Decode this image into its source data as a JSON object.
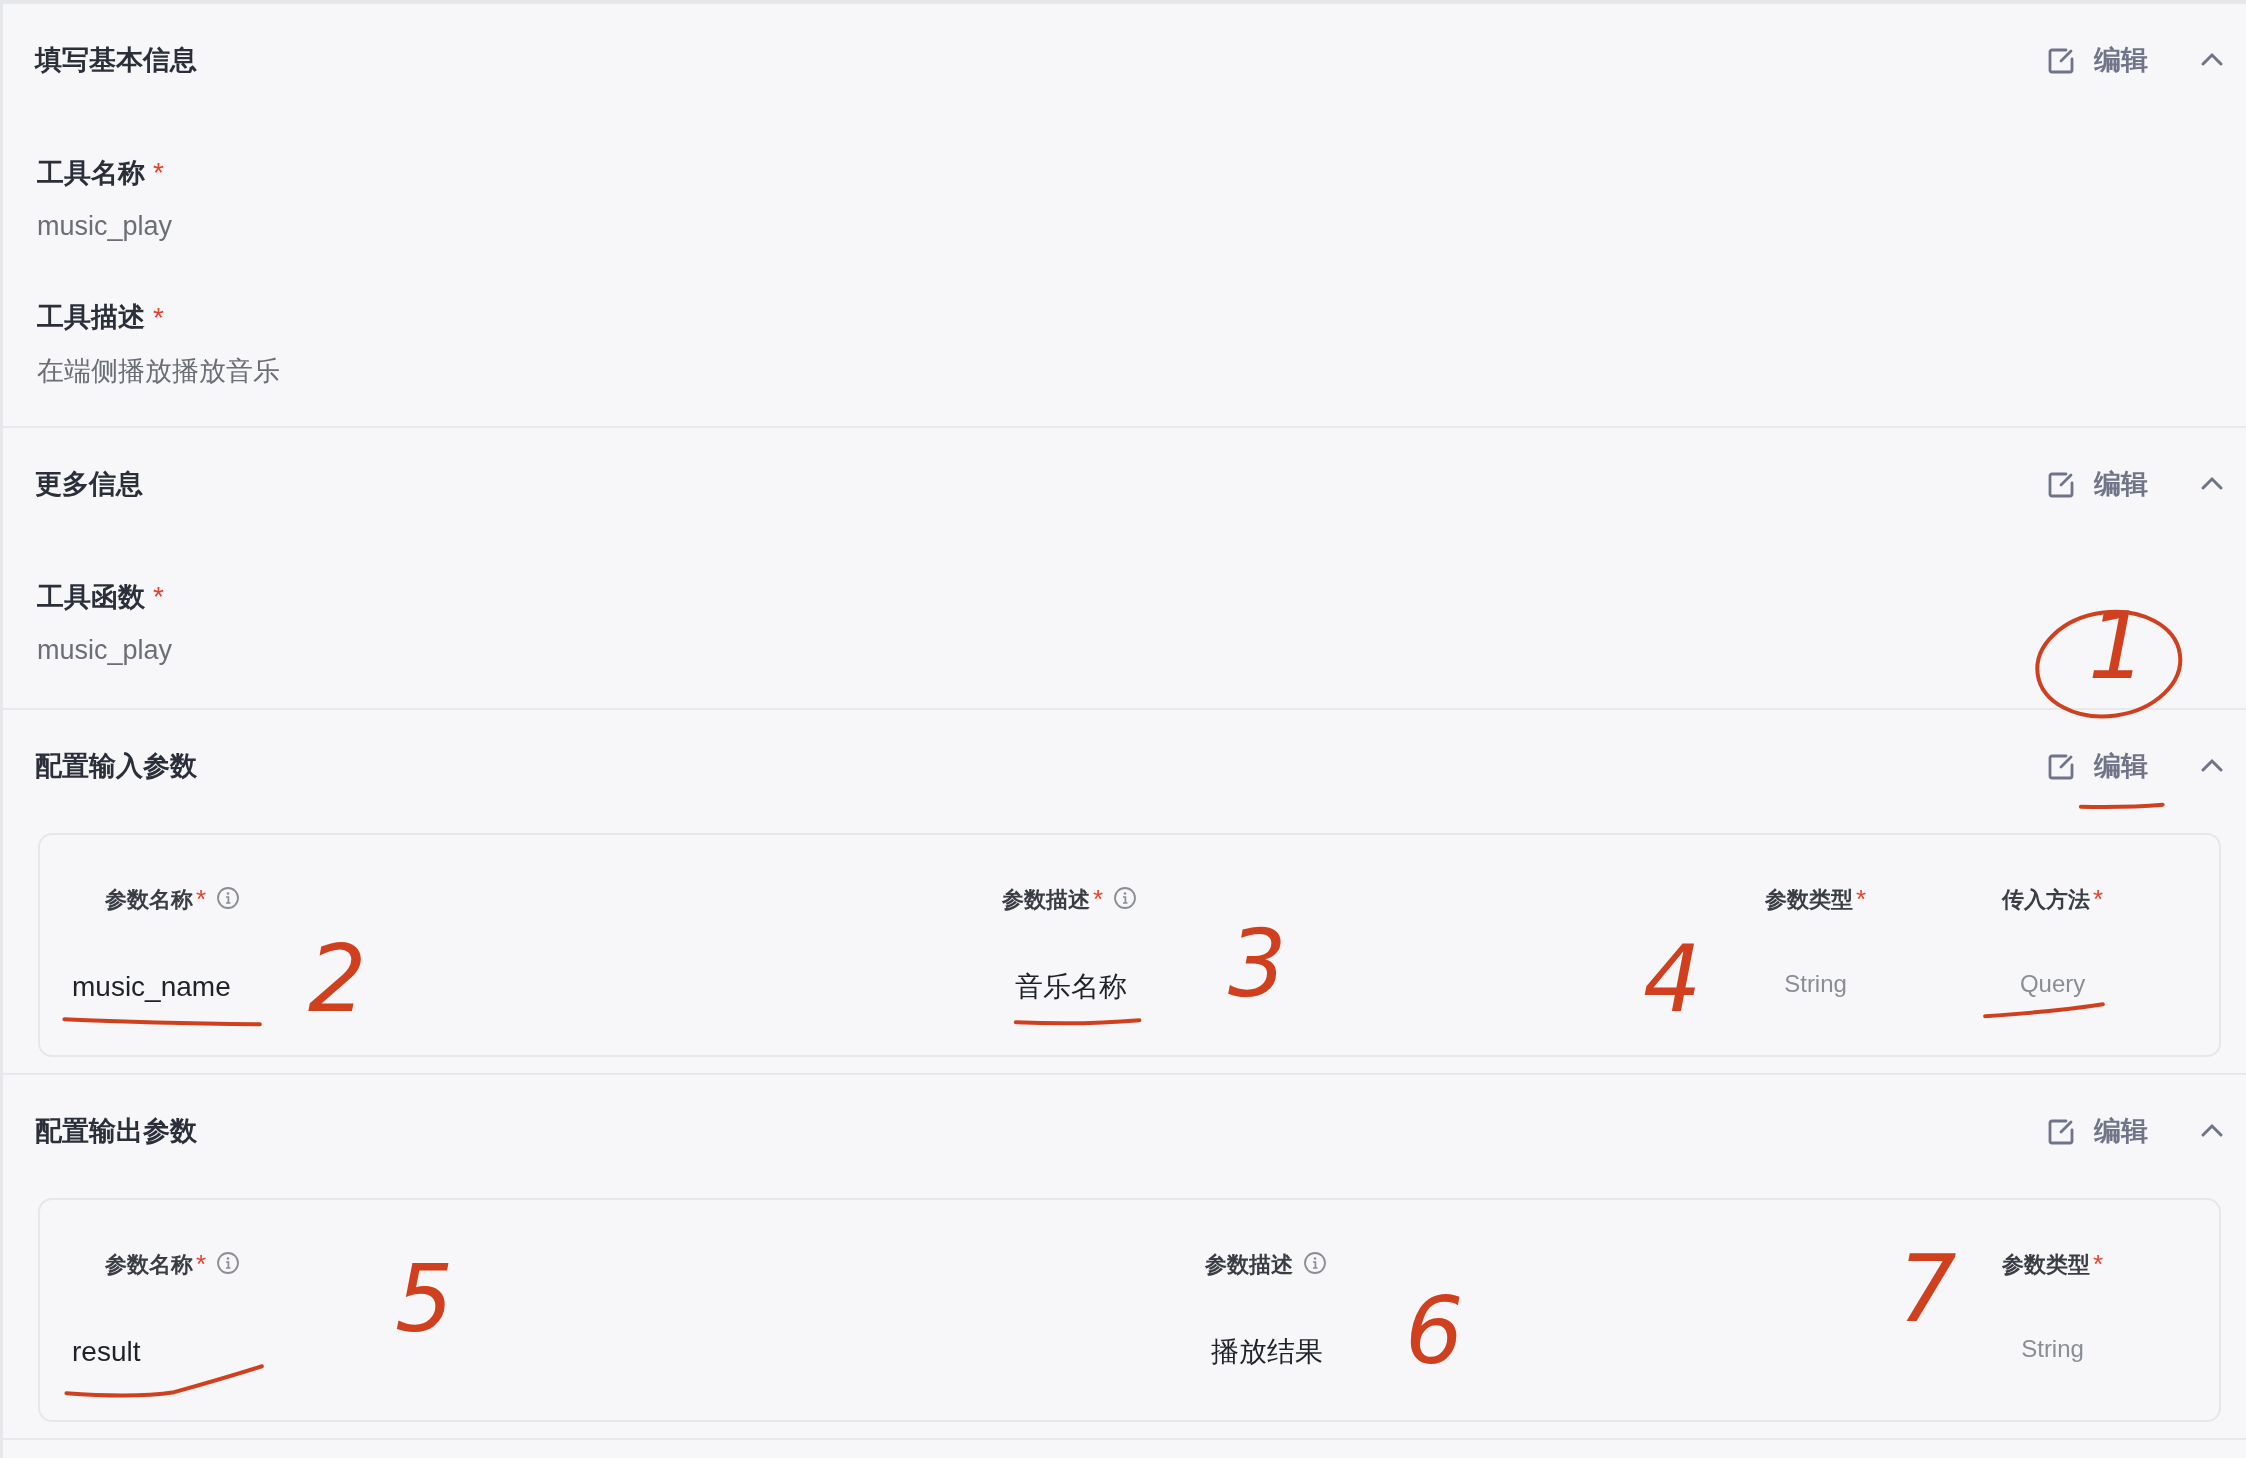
{
  "sections": [
    {
      "title": "填写基本信息",
      "edit": "编辑",
      "expanded": true,
      "fields": [
        {
          "label": "工具名称",
          "required": "*",
          "value": "music_play"
        },
        {
          "label": "工具描述",
          "required": "*",
          "value": "在端侧播放播放音乐"
        }
      ]
    },
    {
      "title": "更多信息",
      "edit": "编辑",
      "expanded": true,
      "fields": [
        {
          "label": "工具函数",
          "required": "*",
          "value": "music_play"
        }
      ]
    },
    {
      "title": "配置输入参数",
      "edit": "编辑",
      "expanded": true,
      "kind": "input",
      "params": [
        {
          "label": "参数名称",
          "required": "*",
          "info": true,
          "value": "music_name"
        },
        {
          "label": "参数描述",
          "required": "*",
          "info": true,
          "value": "音乐名称"
        },
        {
          "label": "参数类型",
          "required": "*",
          "value": "String"
        },
        {
          "label": "传入方法",
          "required": "*",
          "value": "Query"
        }
      ]
    },
    {
      "title": "配置输出参数",
      "edit": "编辑",
      "expanded": true,
      "kind": "output",
      "params": [
        {
          "label": "参数名称",
          "required": "*",
          "info": true,
          "value": "result"
        },
        {
          "label": "参数描述",
          "info": true,
          "value": "播放结果"
        },
        {
          "label": "参数类型",
          "required": "*",
          "value": "String"
        }
      ]
    }
  ],
  "annotations": [
    {
      "text": "1"
    },
    {
      "text": "2"
    },
    {
      "text": "3"
    },
    {
      "text": "4"
    },
    {
      "text": "5"
    },
    {
      "text": "6"
    },
    {
      "text": "7"
    }
  ]
}
